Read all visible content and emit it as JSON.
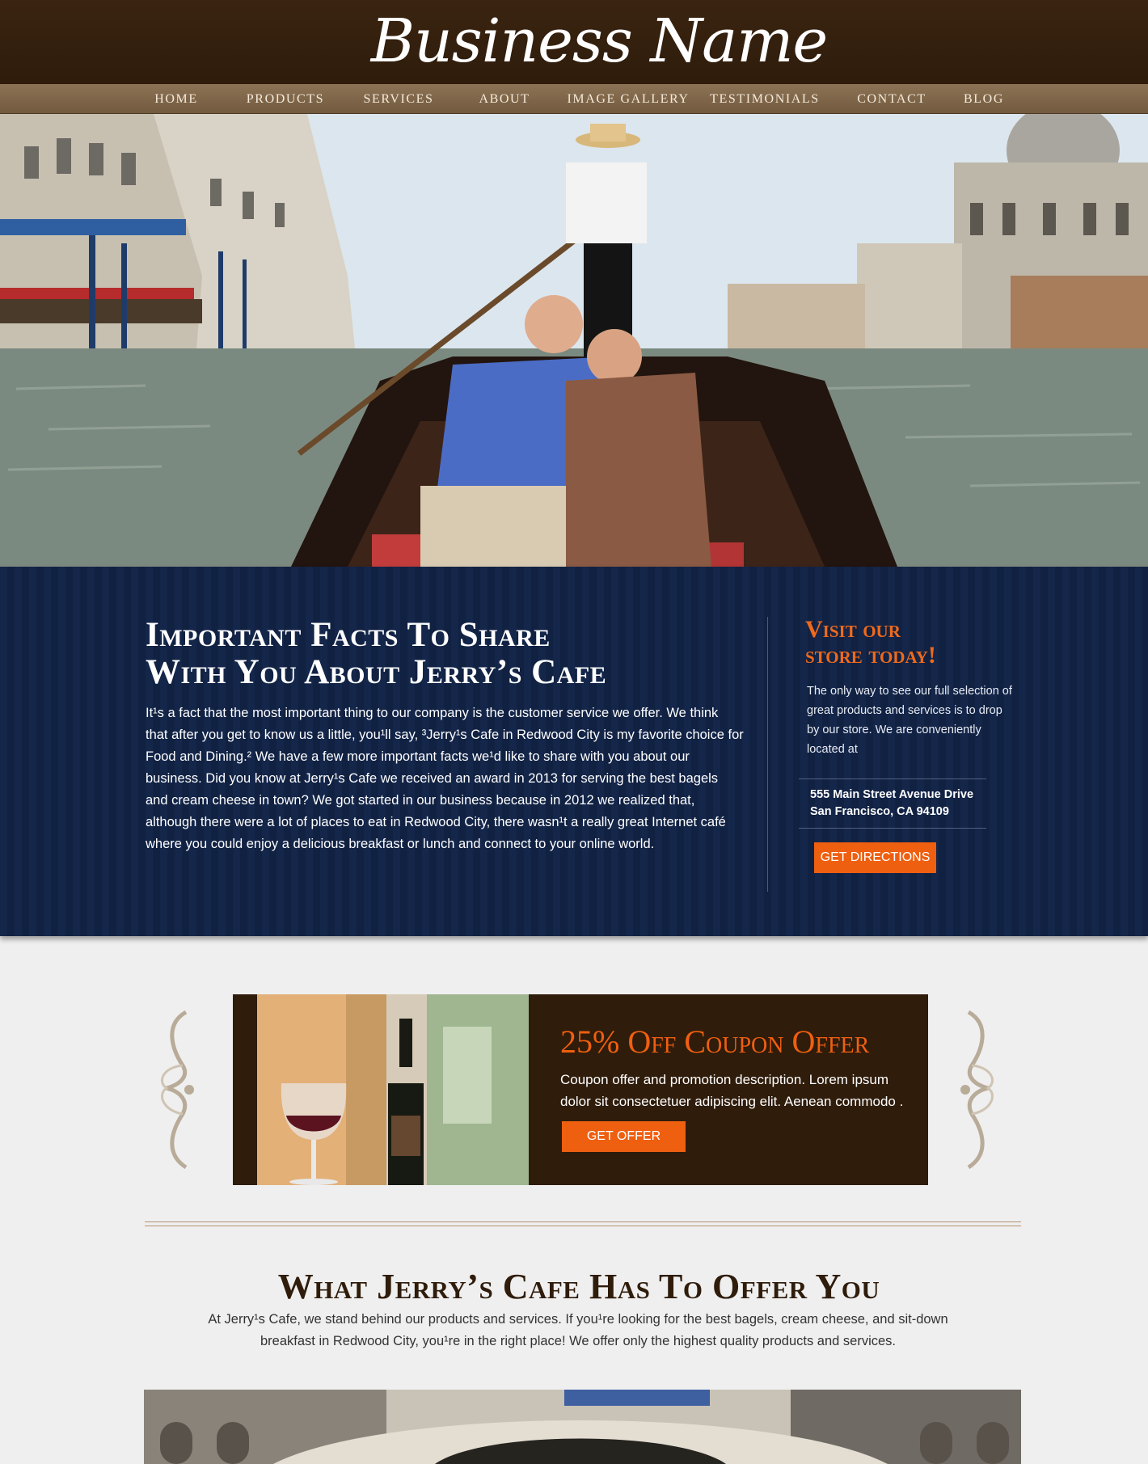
{
  "header": {
    "brand": "Business Name"
  },
  "nav": {
    "items": [
      {
        "label": "HOME"
      },
      {
        "label": "PRODUCTS"
      },
      {
        "label": "SERVICES"
      },
      {
        "label": "ABOUT"
      },
      {
        "label": "IMAGE GALLERY"
      },
      {
        "label": "TESTIMONIALS"
      },
      {
        "label": "CONTACT"
      },
      {
        "label": "BLOG"
      }
    ]
  },
  "facts": {
    "title_line1": "Important Facts To Share",
    "title_line2": "With You About Jerry’s Cafe",
    "body": "It¹s a fact that the most important thing to our company is the customer service we offer. We think that after you get to know us a little, you¹ll say, ³Jerry¹s Cafe in Redwood City is my favorite choice for Food and Dining.² We have a few more important facts we¹d like to share with you about our business. Did you know at Jerry¹s Cafe we received an award in 2013 for serving the best bagels and cream cheese in town? We got started in our business because in 2012 we realized that, although there were a lot of places to eat in Redwood City, there wasn¹t a really great Internet café where you could enjoy a delicious breakfast or lunch and connect to your online world."
  },
  "visit": {
    "title_line1": "Visit our",
    "title_line2": "store today!",
    "body": "The only way to see our full selection of great  products and services is to drop by our store.  We are conveniently located at",
    "address_line1": "555 Main Street Avenue Drive",
    "address_line2": "San  Francisco, CA 94109",
    "button": "GET DIRECTIONS"
  },
  "coupon": {
    "title": "25% Off Coupon Offer",
    "body": "Coupon offer and promotion description. Lorem ipsum dolor sit consectetuer adipiscing elit. Aenean commodo .",
    "button": "GET OFFER"
  },
  "offer": {
    "title": "What Jerry’s Cafe Has To Offer You",
    "body": "At Jerry¹s Cafe, we stand behind our products and services. If you¹re looking for the best bagels,  cream cheese, and sit-down breakfast in  Redwood City, you¹re in the right place! We offer only the highest quality products and  services."
  },
  "colors": {
    "header_brown": "#2f1c0b",
    "nav_tan": "#7d6448",
    "navy": "#14264a",
    "accent_orange": "#ee5f10",
    "page_bg": "#efefef"
  }
}
